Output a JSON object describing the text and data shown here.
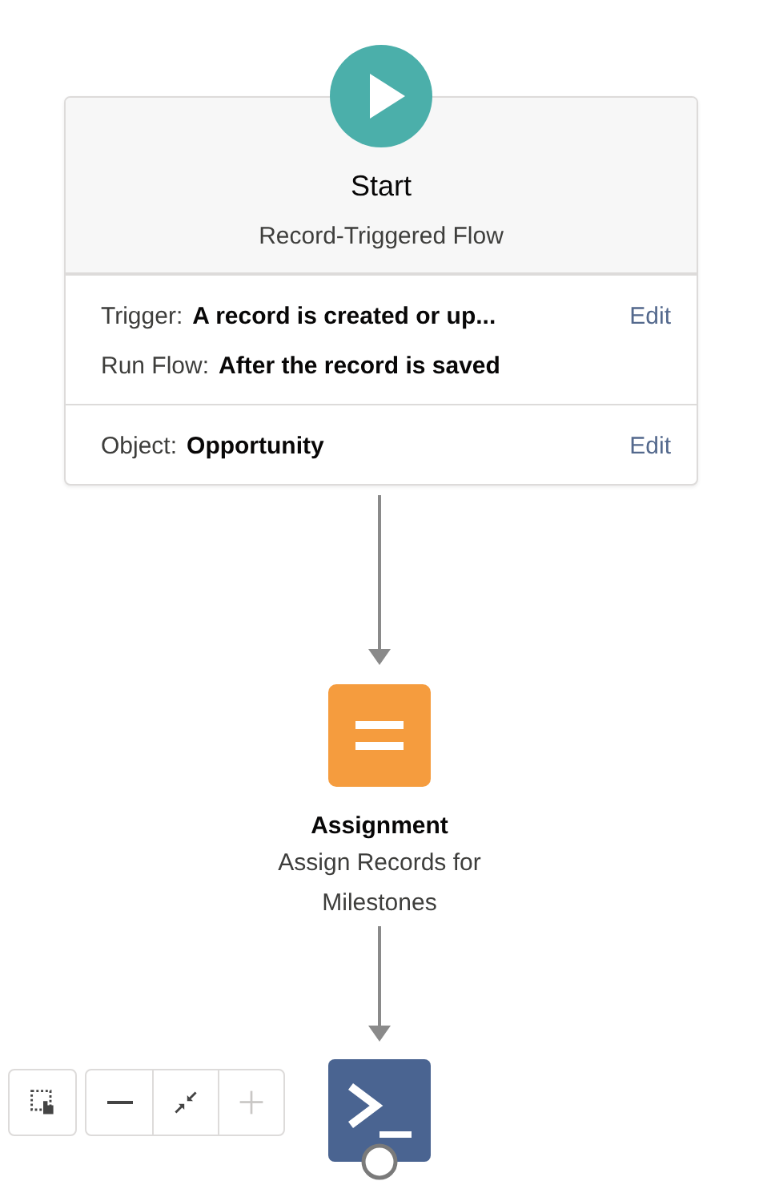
{
  "start": {
    "title": "Start",
    "subtitle": "Record-Triggered Flow",
    "sections": [
      {
        "rows": [
          {
            "label": "Trigger:",
            "value": "A record is created or up...",
            "action": "Edit"
          },
          {
            "label": "Run Flow:",
            "value": "After the record is saved"
          }
        ]
      },
      {
        "rows": [
          {
            "label": "Object:",
            "value": "Opportunity",
            "action": "Edit"
          }
        ]
      }
    ]
  },
  "assignment": {
    "kind": "assignment",
    "title": "Assignment",
    "subtitle": "Assign Records for Milestones"
  },
  "next_node": {
    "kind": "action"
  },
  "zoom_controls": [
    {
      "kind": "select",
      "disabled": false
    },
    {
      "kind": "zoom-out",
      "disabled": false
    },
    {
      "kind": "fit",
      "disabled": false
    },
    {
      "kind": "zoom-in",
      "disabled": true
    }
  ]
}
